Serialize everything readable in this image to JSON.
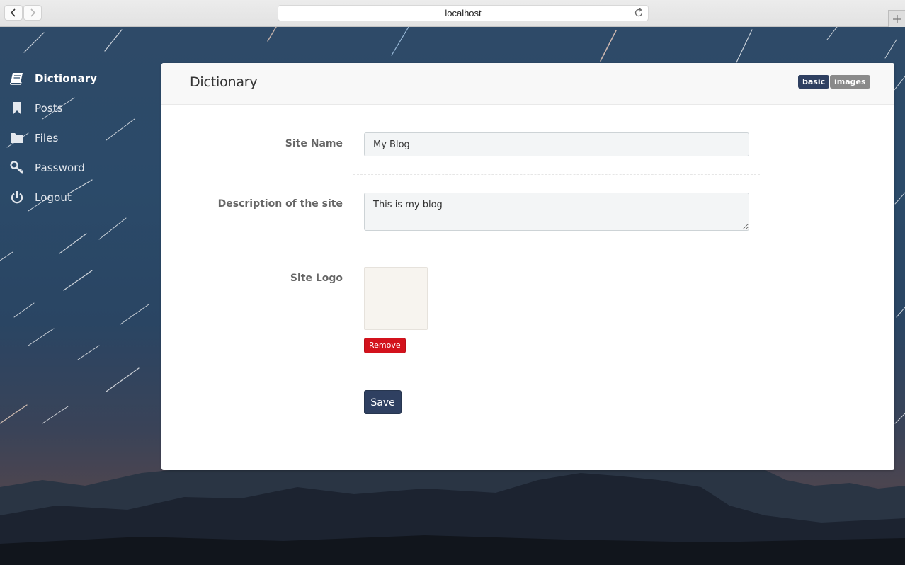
{
  "browser": {
    "address": "localhost",
    "icons": {
      "back": "chevron-left-icon",
      "forward": "chevron-right-icon",
      "reload": "reload-icon",
      "new_tab": "plus-icon"
    }
  },
  "sidebar": {
    "items": [
      {
        "label": "Dictionary",
        "icon": "book-icon",
        "active": true
      },
      {
        "label": "Posts",
        "icon": "bookmark-icon",
        "active": false
      },
      {
        "label": "Files",
        "icon": "folder-icon",
        "active": false
      },
      {
        "label": "Password",
        "icon": "key-icon",
        "active": false
      },
      {
        "label": "Logout",
        "icon": "power-icon",
        "active": false
      }
    ]
  },
  "panel": {
    "title": "Dictionary",
    "tags": [
      {
        "label": "basic",
        "color": "#2f4061",
        "active": true
      },
      {
        "label": "images",
        "color": "#8a8a8a",
        "active": false
      }
    ]
  },
  "form": {
    "site_name": {
      "label": "Site Name",
      "value": "My Blog"
    },
    "description": {
      "label": "Description of the site",
      "value": "This is my blog"
    },
    "site_logo": {
      "label": "Site Logo",
      "remove_label": "Remove"
    },
    "save_label": "Save"
  },
  "colors": {
    "accent": "#2f4061",
    "danger": "#d3121c"
  }
}
